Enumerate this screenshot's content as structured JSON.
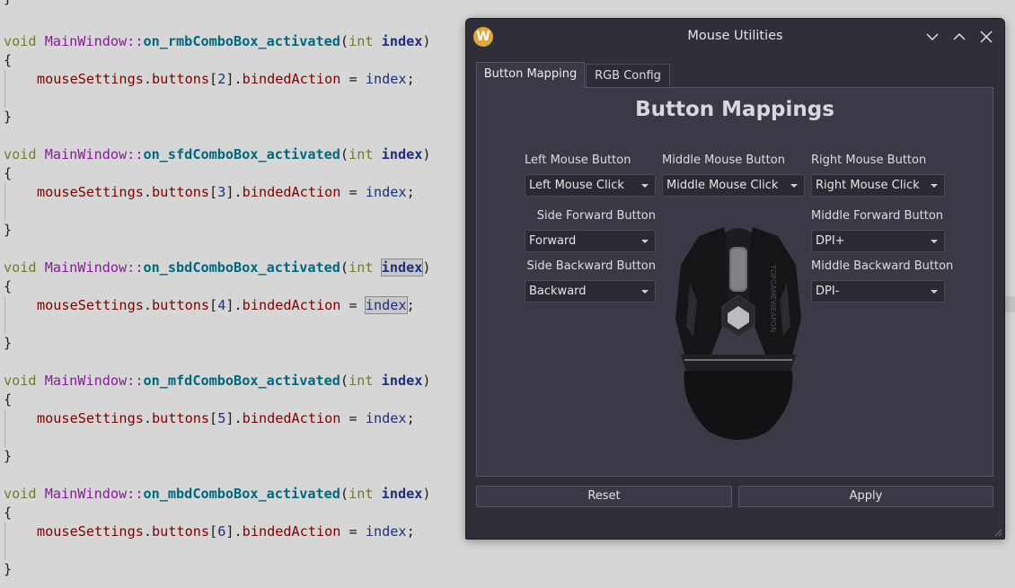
{
  "editor": {
    "top_brace_close": "}",
    "functions": [
      {
        "ret": "void",
        "cls": "MainWindow",
        "sep": "::",
        "name": "on_rmbComboBox_activated",
        "open_paren": "(",
        "ptype": "int",
        "pname": "index",
        "close_paren": ")",
        "open_brace": "{",
        "obj": "mouseSettings",
        "dot1": ".",
        "member": "buttons",
        "lb": "[",
        "idx": "2",
        "rb": "]",
        "dot2": ".",
        "field": "bindedAction",
        "assign": " = ",
        "rhs": "index",
        "semi": ";",
        "close_brace": "}"
      },
      {
        "ret": "void",
        "cls": "MainWindow",
        "sep": "::",
        "name": "on_sfdComboBox_activated",
        "open_paren": "(",
        "ptype": "int",
        "pname": "index",
        "close_paren": ")",
        "open_brace": "{",
        "obj": "mouseSettings",
        "dot1": ".",
        "member": "buttons",
        "lb": "[",
        "idx": "3",
        "rb": "]",
        "dot2": ".",
        "field": "bindedAction",
        "assign": " = ",
        "rhs": "index",
        "semi": ";",
        "close_brace": "}"
      },
      {
        "ret": "void",
        "cls": "MainWindow",
        "sep": "::",
        "name": "on_sbdComboBox_activated",
        "open_paren": "(",
        "ptype": "int",
        "pname": "index",
        "close_paren": ")",
        "open_brace": "{",
        "obj": "mouseSettings",
        "dot1": ".",
        "member": "buttons",
        "lb": "[",
        "idx": "4",
        "rb": "]",
        "dot2": ".",
        "field": "bindedAction",
        "assign": " = ",
        "rhs": "index",
        "semi": ";",
        "close_brace": "}"
      },
      {
        "ret": "void",
        "cls": "MainWindow",
        "sep": "::",
        "name": "on_mfdComboBox_activated",
        "open_paren": "(",
        "ptype": "int",
        "pname": "index",
        "close_paren": ")",
        "open_brace": "{",
        "obj": "mouseSettings",
        "dot1": ".",
        "member": "buttons",
        "lb": "[",
        "idx": "5",
        "rb": "]",
        "dot2": ".",
        "field": "bindedAction",
        "assign": " = ",
        "rhs": "index",
        "semi": ";",
        "close_brace": "}"
      },
      {
        "ret": "void",
        "cls": "MainWindow",
        "sep": "::",
        "name": "on_mbdComboBox_activated",
        "open_paren": "(",
        "ptype": "int",
        "pname": "index",
        "close_paren": ")",
        "open_brace": "{",
        "obj": "mouseSettings",
        "dot1": ".",
        "member": "buttons",
        "lb": "[",
        "idx": "6",
        "rb": "]",
        "dot2": ".",
        "field": "bindedAction",
        "assign": " = ",
        "rhs": "index",
        "semi": ";",
        "close_brace": "}"
      }
    ]
  },
  "dialog": {
    "logo_letter": "W",
    "title": "Mouse Utilities",
    "tabs": [
      {
        "label": "Button Mapping"
      },
      {
        "label": "RGB Config"
      }
    ],
    "heading": "Button Mappings",
    "fields": {
      "left": {
        "label": "Left Mouse Button",
        "value": "Left Mouse Click"
      },
      "middle": {
        "label": "Middle Mouse Button",
        "value": "Middle Mouse Click"
      },
      "right": {
        "label": "Right Mouse Button",
        "value": "Right Mouse Click"
      },
      "side_forward": {
        "label": "Side Forward Button",
        "value": "Forward"
      },
      "side_backward": {
        "label": "Side Backward Button",
        "value": "Backward"
      },
      "middle_forward": {
        "label": "Middle Forward Button",
        "value": "DPI+"
      },
      "middle_backward": {
        "label": "Middle Backward Button",
        "value": "DPI-"
      }
    },
    "mouse_brand_text": "TOPGAMEWEAPON",
    "reset_label": "Reset",
    "apply_label": "Apply",
    "colors": {
      "logo": "#e2a63a",
      "window_bg": "#2f2f3a",
      "panel_bg": "#3a3a46"
    }
  }
}
